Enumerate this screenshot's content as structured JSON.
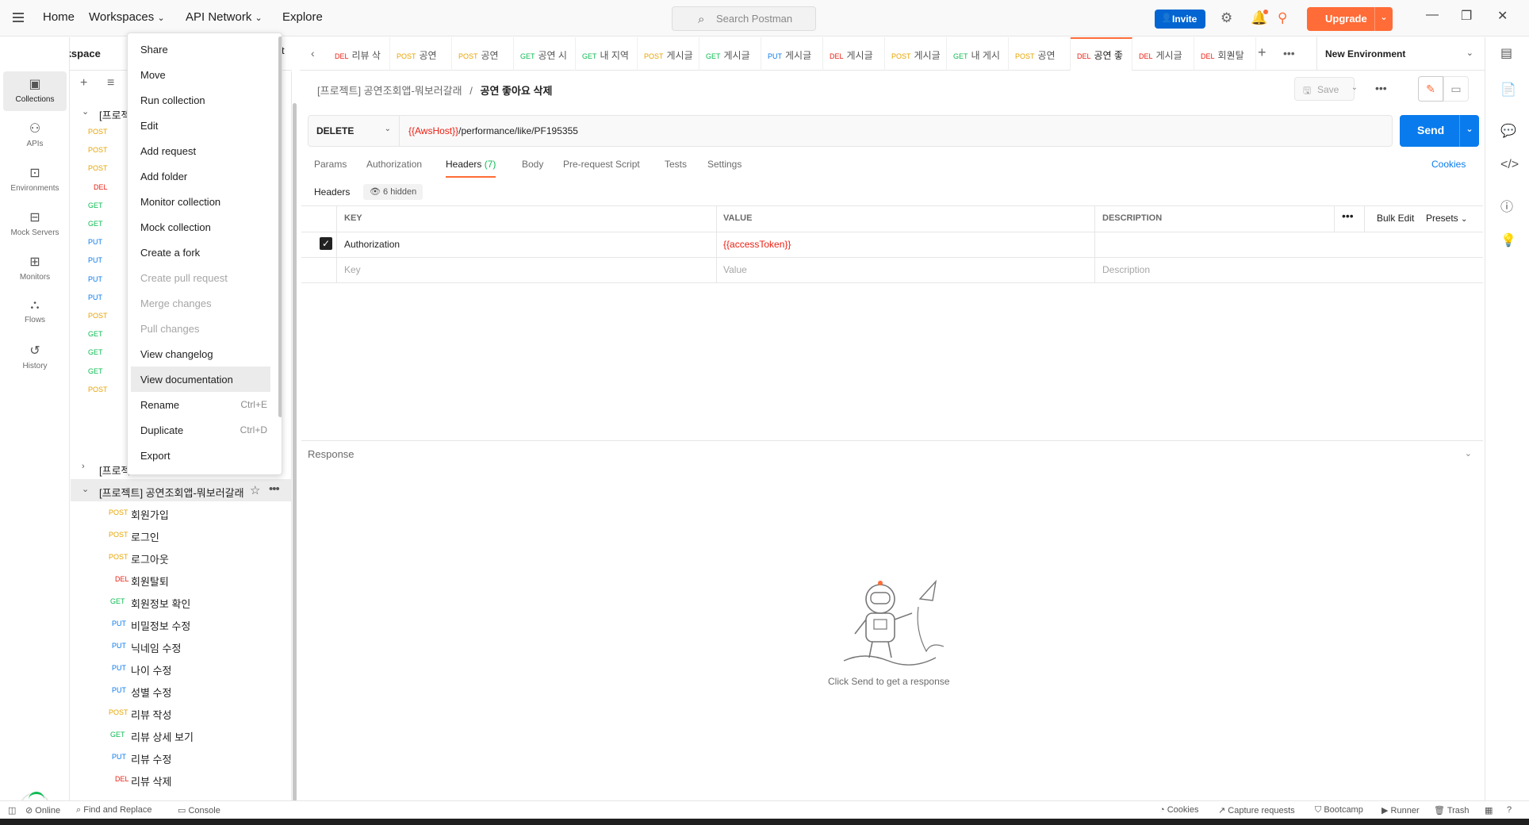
{
  "topbar": {
    "home": "Home",
    "workspaces": "Workspaces",
    "api_network": "API Network",
    "explore": "Explore",
    "search_placeholder": "Search Postman",
    "invite": "Invite",
    "upgrade": "Upgrade"
  },
  "workspace": {
    "name": "My Workspace"
  },
  "rail": [
    {
      "label": "Collections",
      "icon": "collections-icon"
    },
    {
      "label": "APIs",
      "icon": "apis-icon"
    },
    {
      "label": "Environments",
      "icon": "environments-icon"
    },
    {
      "label": "Mock Servers",
      "icon": "mock-servers-icon"
    },
    {
      "label": "Monitors",
      "icon": "monitors-icon"
    },
    {
      "label": "Flows",
      "icon": "flows-icon"
    },
    {
      "label": "History",
      "icon": "history-icon"
    }
  ],
  "sidebar": {
    "partial_label": "t",
    "collapsed_collection_a": "[프로젝t",
    "collapsed_collection_b": "[프로젝",
    "hidden_methods": [
      "POST",
      "POST",
      "POST",
      "DEL",
      "GET",
      "GET",
      "PUT",
      "PUT",
      "PUT",
      "PUT",
      "POST",
      "GET",
      "GET",
      "GET",
      "POST"
    ],
    "open_collection": "[프로젝트] 공연조회앱-뭐보러갈래",
    "requests": [
      {
        "method": "POST",
        "name": "회원가입"
      },
      {
        "method": "POST",
        "name": "로그인"
      },
      {
        "method": "POST",
        "name": "로그아웃"
      },
      {
        "method": "DEL",
        "name": "회원탈퇴"
      },
      {
        "method": "GET",
        "name": "회원정보 확인"
      },
      {
        "method": "PUT",
        "name": "비밀정보 수정"
      },
      {
        "method": "PUT",
        "name": "닉네임 수정"
      },
      {
        "method": "PUT",
        "name": "나이 수정"
      },
      {
        "method": "PUT",
        "name": "성별 수정"
      },
      {
        "method": "POST",
        "name": "리뷰 작성"
      },
      {
        "method": "GET",
        "name": "리뷰 상세 보기"
      },
      {
        "method": "PUT",
        "name": "리뷰 수정"
      },
      {
        "method": "DEL",
        "name": "리뷰 삭제"
      }
    ]
  },
  "context_menu": {
    "items": [
      {
        "label": "Share",
        "shortcut": "",
        "disabled": false
      },
      {
        "label": "Move",
        "shortcut": "",
        "disabled": false
      },
      {
        "label": "Run collection",
        "shortcut": "",
        "disabled": false
      },
      {
        "label": "Edit",
        "shortcut": "",
        "disabled": false
      },
      {
        "label": "Add request",
        "shortcut": "",
        "disabled": false
      },
      {
        "label": "Add folder",
        "shortcut": "",
        "disabled": false
      },
      {
        "label": "Monitor collection",
        "shortcut": "",
        "disabled": false
      },
      {
        "label": "Mock collection",
        "shortcut": "",
        "disabled": false
      },
      {
        "label": "Create a fork",
        "shortcut": "",
        "disabled": false
      },
      {
        "label": "Create pull request",
        "shortcut": "",
        "disabled": true
      },
      {
        "label": "Merge changes",
        "shortcut": "",
        "disabled": true
      },
      {
        "label": "Pull changes",
        "shortcut": "",
        "disabled": true
      },
      {
        "label": "View changelog",
        "shortcut": "",
        "disabled": false
      },
      {
        "label": "View documentation",
        "shortcut": "",
        "disabled": false
      },
      {
        "label": "Rename",
        "shortcut": "Ctrl+E",
        "disabled": false
      },
      {
        "label": "Duplicate",
        "shortcut": "Ctrl+D",
        "disabled": false
      },
      {
        "label": "Export",
        "shortcut": "",
        "disabled": false
      }
    ]
  },
  "tabs": [
    {
      "method": "DEL",
      "name": "리뷰 삭"
    },
    {
      "method": "POST",
      "name": "공연"
    },
    {
      "method": "POST",
      "name": "공연"
    },
    {
      "method": "GET",
      "name": "공연 시"
    },
    {
      "method": "GET",
      "name": "내 지역"
    },
    {
      "method": "POST",
      "name": "게시글"
    },
    {
      "method": "GET",
      "name": "게시글"
    },
    {
      "method": "PUT",
      "name": "게시글"
    },
    {
      "method": "DEL",
      "name": "게시글"
    },
    {
      "method": "POST",
      "name": "게시글"
    },
    {
      "method": "GET",
      "name": "내 게시"
    },
    {
      "method": "POST",
      "name": "공연"
    },
    {
      "method": "DEL",
      "name": "공연 좋"
    },
    {
      "method": "DEL",
      "name": "게시글"
    },
    {
      "method": "DEL",
      "name": "회원탈"
    }
  ],
  "environment": "New Environment",
  "request": {
    "breadcrumb_collection": "[프로젝트] 공연조회앱-뭐보러갈래",
    "breadcrumb_sep": "/",
    "breadcrumb_request": "공연 좋아요 삭제",
    "save": "Save",
    "method": "DELETE",
    "url_var": "{{AwsHost}}",
    "url_path": "/performance/like/PF195355",
    "send": "Send"
  },
  "req_tabs": {
    "params": "Params",
    "authorization": "Authorization",
    "headers": "Headers",
    "headers_count": "(7)",
    "body": "Body",
    "prerequest": "Pre-request Script",
    "tests": "Tests",
    "settings": "Settings",
    "cookies": "Cookies"
  },
  "headers_section": {
    "label": "Headers",
    "hidden": "6 hidden",
    "col_key": "KEY",
    "col_value": "VALUE",
    "col_description": "DESCRIPTION",
    "bulk_edit": "Bulk Edit",
    "presets": "Presets",
    "row_key": "Authorization",
    "row_value": "{{accessToken}}",
    "key_placeholder": "Key",
    "value_placeholder": "Value",
    "description_placeholder": "Description"
  },
  "response": {
    "title": "Response",
    "empty_message": "Click Send to get a response"
  },
  "statusbar": {
    "online": "Online",
    "find_replace": "Find and Replace",
    "console": "Console",
    "cookies": "Cookies",
    "capture": "Capture requests",
    "bootcamp": "Bootcamp",
    "runner": "Runner",
    "trash": "Trash"
  },
  "colors": {
    "accent": "#ff6c37",
    "send_blue": "#097bed",
    "post": "#e7a400",
    "get": "#0cbb52",
    "put": "#097bed",
    "del": "#eb2013"
  }
}
